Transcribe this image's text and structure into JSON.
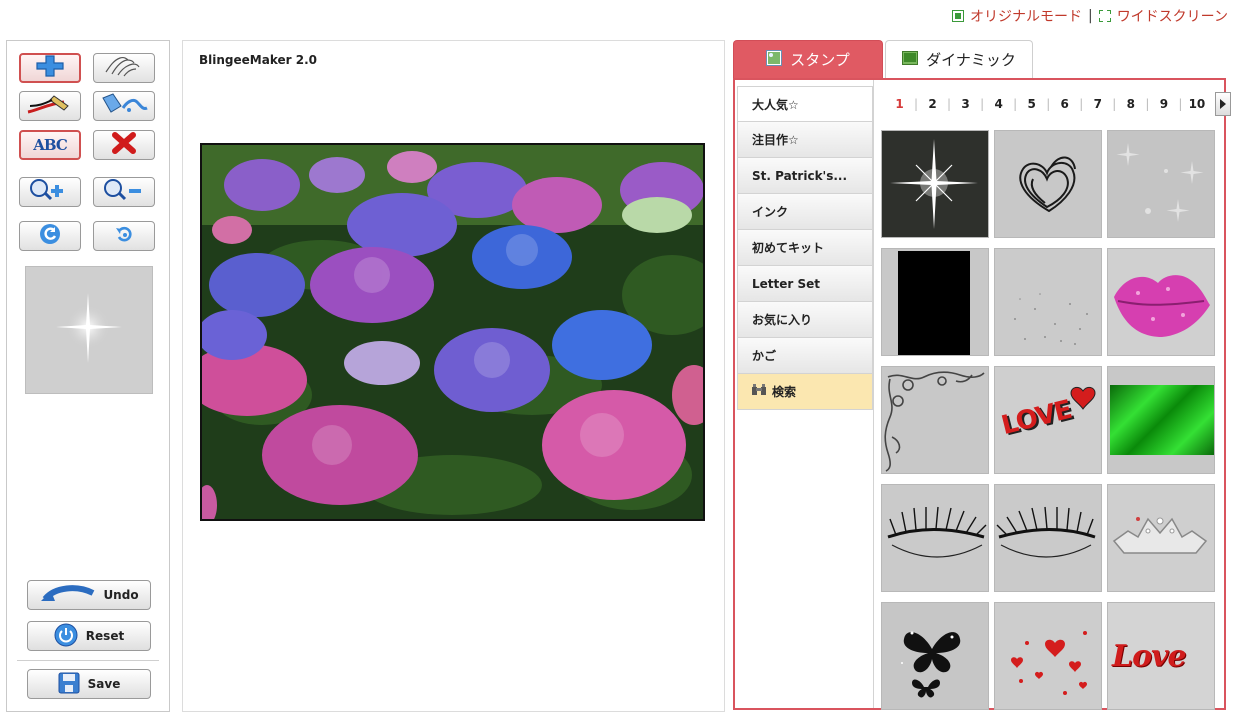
{
  "top_links": {
    "original_mode": "オリジナルモード",
    "separator": "|",
    "wide_screen": "ワイドスクリーン"
  },
  "toolbar": {
    "tools": [
      {
        "name": "move",
        "icon": "plus-cross-icon",
        "selected": true
      },
      {
        "name": "pan",
        "icon": "hand-icon",
        "selected": false
      },
      {
        "name": "draw",
        "icon": "pen-icon",
        "selected": false
      },
      {
        "name": "fill",
        "icon": "paint-bucket-icon",
        "selected": false
      },
      {
        "name": "text",
        "icon": "abc-text-icon",
        "selected": false
      },
      {
        "name": "delete",
        "icon": "red-x-icon",
        "selected": false
      },
      {
        "name": "zoom-in",
        "icon": "magnifier-plus-icon",
        "selected": false
      },
      {
        "name": "zoom-out",
        "icon": "magnifier-minus-icon",
        "selected": false
      },
      {
        "name": "rotate-left",
        "icon": "rotate-left-icon",
        "selected": false
      },
      {
        "name": "rotate-right",
        "icon": "rotate-right-icon",
        "selected": false
      }
    ],
    "abc_text": "ABC",
    "undo_label": "Undo",
    "reset_label": "Reset",
    "save_label": "Save"
  },
  "canvas": {
    "title": "BlingeeMaker 2.0"
  },
  "tabs": [
    {
      "label": "スタンプ",
      "active": true
    },
    {
      "label": "ダイナミック",
      "active": false
    }
  ],
  "categories": [
    "大人気☆",
    "注目作☆",
    "St. Patrick's...",
    "インク",
    "初めてキット",
    "Letter Set",
    "お気に入り",
    "かご",
    "検索"
  ],
  "pagination": {
    "pages": [
      "1",
      "2",
      "3",
      "4",
      "5",
      "6",
      "7",
      "8",
      "9",
      "10"
    ],
    "current": "1"
  },
  "stamps": [
    "sparkle-star",
    "scribble-heart",
    "faint-sparkles",
    "black-bar",
    "glitter-dust",
    "pink-lips",
    "ornament-corner",
    "love-text-red",
    "green-gradient",
    "eyelashes-left",
    "eyelashes-right",
    "silver-tiara",
    "black-butterflies",
    "red-hearts",
    "love-glitter-text"
  ],
  "stamp_texts": {
    "love_block": "LOVE",
    "love_script": "Love"
  },
  "colors": {
    "accent_red": "#d9545e",
    "active_tab": "#e05a63",
    "search_bg": "#fbe7b0",
    "current_page": "#d63a3a"
  }
}
